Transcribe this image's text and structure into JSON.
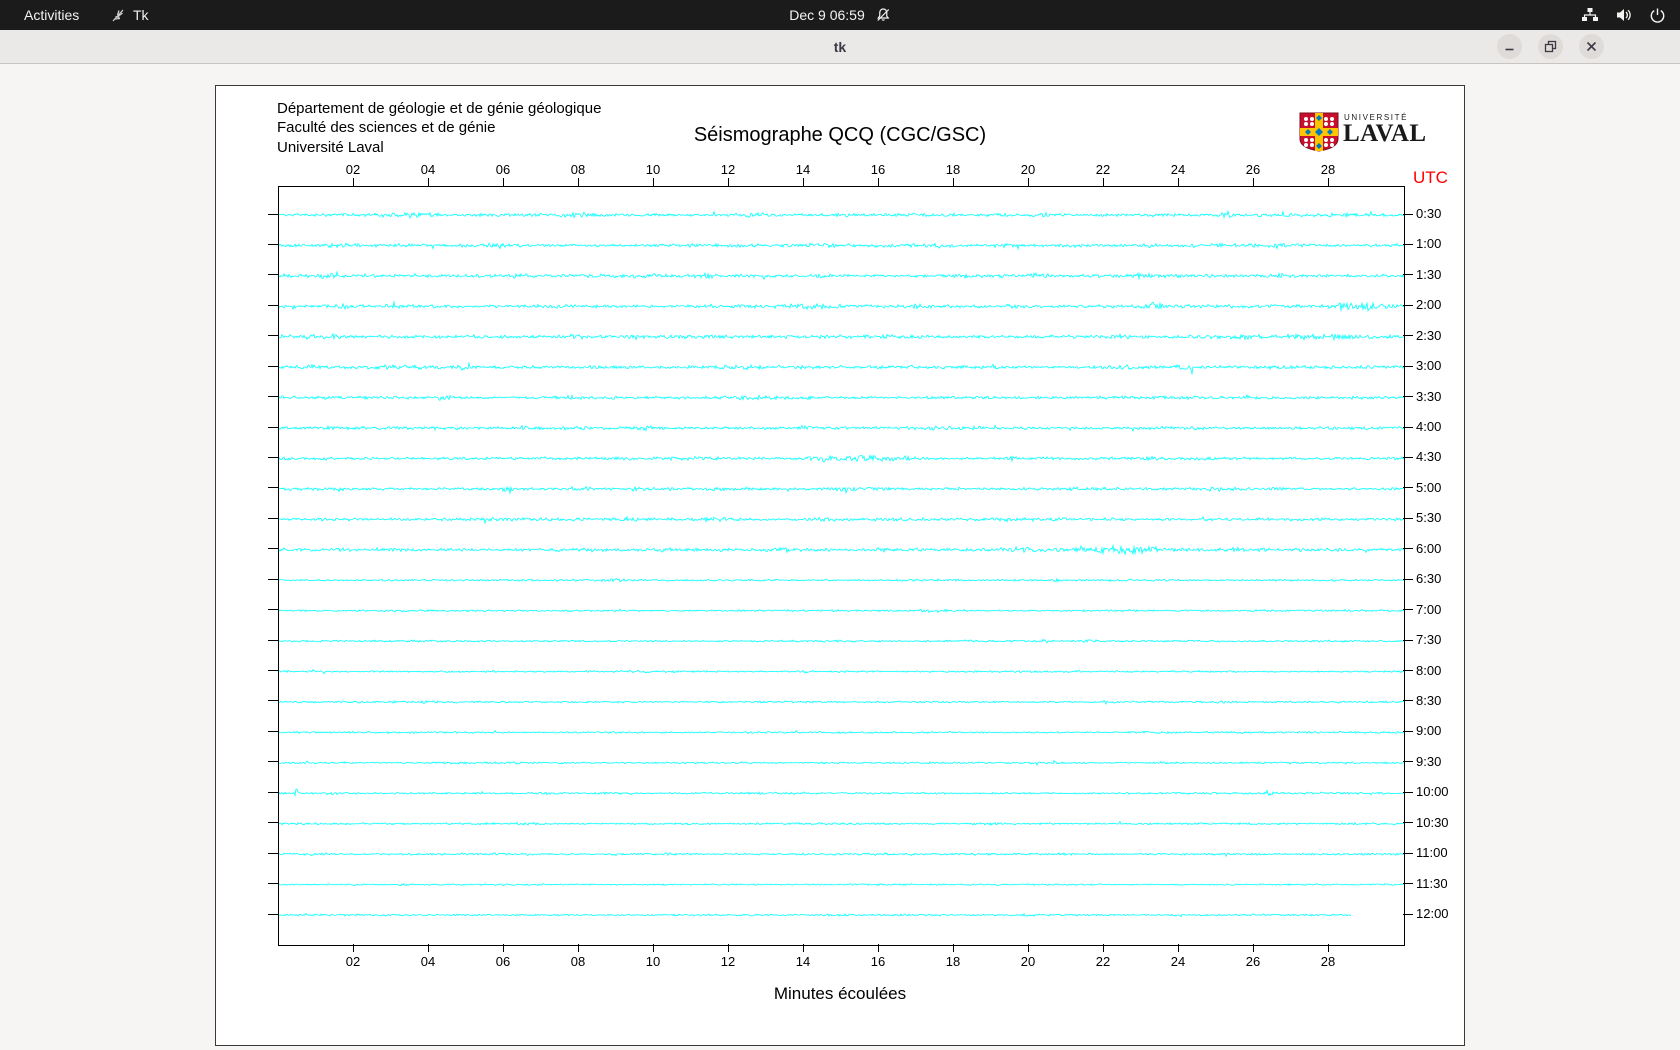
{
  "topbar": {
    "activities_label": "Activities",
    "app_name": "Tk",
    "clock": "Dec 9  06:59",
    "status_icons": [
      "network-wired-icon",
      "volume-icon",
      "power-icon"
    ],
    "notifications_muted": true
  },
  "window": {
    "title": "tk",
    "controls": [
      "minimize",
      "maximize",
      "close"
    ]
  },
  "header": {
    "line1": "Département de géologie et de génie géologique",
    "line2": "Faculté des sciences et de génie",
    "line3": "Université Laval",
    "title": "Séismographe QCQ (CGC/GSC)",
    "logo": {
      "line1": "UNIVERSITÉ",
      "line2": "LAVAL"
    }
  },
  "chart_data": {
    "type": "line",
    "title": "Séismographe QCQ (CGC/GSC)",
    "xlabel": "Minutes écoulées",
    "x_range": [
      0,
      30
    ],
    "x_ticks": [
      "02",
      "04",
      "06",
      "08",
      "10",
      "12",
      "14",
      "16",
      "18",
      "20",
      "22",
      "24",
      "26",
      "28"
    ],
    "right_axis_title": "UTC",
    "trace_color": "#00ffff",
    "grid": false,
    "traces": [
      {
        "label": "0:30",
        "base": 2.0,
        "end": 30,
        "events": [
          [
            3.5,
            0.5,
            2
          ],
          [
            8,
            0.3,
            1.2
          ],
          [
            12.6,
            0.4,
            1.5
          ],
          [
            20.5,
            0.3,
            1.5
          ],
          [
            25.3,
            0.15,
            3
          ],
          [
            26.8,
            0.2,
            2
          ]
        ]
      },
      {
        "label": "1:00",
        "base": 2.0,
        "end": 30,
        "events": [
          [
            5.9,
            0.3,
            1.5
          ],
          [
            14.5,
            0.3,
            1.2
          ],
          [
            17.5,
            0.4,
            1.5
          ],
          [
            19.2,
            0.3,
            1.5
          ],
          [
            23.2,
            0.2,
            1.2
          ]
        ]
      },
      {
        "label": "1:30",
        "base": 2.0,
        "end": 30,
        "events": [
          [
            1.3,
            0.3,
            1.6
          ],
          [
            6.4,
            0.3,
            1.5
          ],
          [
            11.5,
            0.5,
            1.6
          ],
          [
            14.3,
            0.3,
            1.4
          ],
          [
            20.3,
            0.25,
            2.8
          ],
          [
            23,
            0.2,
            1.4
          ],
          [
            26.6,
            0.3,
            1.6
          ]
        ]
      },
      {
        "label": "2:00",
        "base": 2.0,
        "end": 30,
        "events": [
          [
            1.8,
            0.3,
            1.5
          ],
          [
            7.4,
            0.3,
            1.5
          ],
          [
            14.3,
            0.6,
            2
          ],
          [
            17,
            0.3,
            1.4
          ],
          [
            19.5,
            0.3,
            1.6
          ],
          [
            23.3,
            0.3,
            1.5
          ],
          [
            28.8,
            0.8,
            3.2
          ]
        ]
      },
      {
        "label": "2:30",
        "base": 2.0,
        "end": 30,
        "events": [
          [
            1.4,
            0.3,
            1.5
          ],
          [
            8,
            0.5,
            1.8
          ],
          [
            9.6,
            0.3,
            1.5
          ],
          [
            16.5,
            0.3,
            1.2
          ],
          [
            22.5,
            0.3,
            1.5
          ],
          [
            25.8,
            0.25,
            2
          ],
          [
            27.8,
            0.8,
            3.2
          ]
        ]
      },
      {
        "label": "3:00",
        "base": 2.0,
        "end": 30,
        "events": [
          [
            0.8,
            0.25,
            2
          ],
          [
            3.3,
            0.3,
            1.6
          ],
          [
            4.9,
            0.3,
            1.8
          ],
          [
            12.3,
            0.4,
            1.5
          ],
          [
            22.6,
            0.3,
            2
          ],
          [
            24.2,
            0.25,
            1.6
          ]
        ]
      },
      {
        "label": "3:30",
        "base": 1.8,
        "end": 30,
        "events": [
          [
            4.4,
            0.12,
            3.4
          ],
          [
            7.8,
            0.3,
            1.5
          ],
          [
            12.4,
            0.4,
            1.6
          ],
          [
            18,
            0.2,
            1
          ],
          [
            25.9,
            0.15,
            1.8
          ]
        ]
      },
      {
        "label": "4:00",
        "base": 1.8,
        "end": 30,
        "events": [
          [
            1.4,
            0.4,
            1.6
          ],
          [
            6.4,
            0.3,
            1.4
          ],
          [
            9.9,
            0.3,
            1.4
          ],
          [
            14,
            0.3,
            1.2
          ],
          [
            17.4,
            0.3,
            1.3
          ],
          [
            24.5,
            0.2,
            1.2
          ]
        ]
      },
      {
        "label": "4:30",
        "base": 1.8,
        "end": 30,
        "events": [
          [
            14.6,
            0.4,
            2.2
          ],
          [
            15.6,
            0.7,
            2.6
          ],
          [
            16.8,
            0.4,
            1.8
          ],
          [
            19.6,
            0.12,
            2.2
          ],
          [
            23.2,
            0.2,
            1.2
          ]
        ]
      },
      {
        "label": "5:00",
        "base": 1.8,
        "end": 30,
        "events": [
          [
            6.1,
            0.3,
            1.5
          ],
          [
            8.2,
            0.3,
            1.4
          ],
          [
            9.5,
            0.25,
            1.5
          ],
          [
            15.2,
            0.3,
            1.3
          ],
          [
            25,
            0.2,
            1.2
          ]
        ]
      },
      {
        "label": "5:30",
        "base": 1.8,
        "end": 30,
        "events": [
          [
            9.4,
            0.3,
            1.5
          ],
          [
            11.6,
            0.3,
            1.4
          ],
          [
            14.6,
            0.3,
            1.3
          ],
          [
            19.3,
            0.2,
            1.1
          ]
        ]
      },
      {
        "label": "6:00",
        "base": 2.0,
        "end": 30,
        "events": [
          [
            10.4,
            0.3,
            1.6
          ],
          [
            16,
            0.2,
            1.8
          ],
          [
            19.8,
            0.6,
            1.8
          ],
          [
            21.3,
            0.15,
            2.6
          ],
          [
            22.4,
            0.8,
            2.6
          ],
          [
            23.1,
            0.3,
            2.2
          ],
          [
            25.6,
            0.25,
            1.4
          ]
        ]
      },
      {
        "label": "6:30",
        "base": 1.2,
        "end": 30,
        "events": [
          [
            9,
            0.3,
            0.8
          ],
          [
            20.7,
            0.06,
            8
          ]
        ]
      },
      {
        "label": "7:00",
        "base": 1.1,
        "end": 30,
        "events": [
          [
            17.5,
            0.5,
            1
          ],
          [
            26,
            0.2,
            0.7
          ]
        ]
      },
      {
        "label": "7:30",
        "base": 1.1,
        "end": 30,
        "events": [
          [
            20.4,
            0.1,
            1.8
          ],
          [
            21.6,
            0.3,
            1.1
          ]
        ]
      },
      {
        "label": "8:00",
        "base": 1.1,
        "end": 30,
        "events": [
          [
            2.8,
            0.3,
            0.7
          ],
          [
            14,
            0.3,
            0.6
          ]
        ]
      },
      {
        "label": "8:30",
        "base": 1.1,
        "end": 30,
        "events": [
          [
            4,
            2,
            0.5
          ],
          [
            25,
            0.3,
            0.6
          ]
        ]
      },
      {
        "label": "9:00",
        "base": 1.1,
        "end": 30,
        "events": [
          [
            23.2,
            0.2,
            0.9
          ]
        ]
      },
      {
        "label": "9:30",
        "base": 1.1,
        "end": 30,
        "events": [
          [
            12.4,
            0.25,
            1
          ],
          [
            23.6,
            0.2,
            0.9
          ]
        ]
      },
      {
        "label": "10:00",
        "base": 1.2,
        "end": 30,
        "events": [
          [
            0.5,
            0.08,
            6
          ],
          [
            1.3,
            0.2,
            1.6
          ],
          [
            7,
            0.3,
            0.9
          ],
          [
            26.4,
            0.06,
            5
          ]
        ]
      },
      {
        "label": "10:30",
        "base": 1.2,
        "end": 30,
        "events": [
          [
            6.6,
            0.25,
            1
          ],
          [
            19,
            0.25,
            0.9
          ]
        ]
      },
      {
        "label": "11:00",
        "base": 1.2,
        "end": 30,
        "events": [
          [
            1,
            0.25,
            1
          ],
          [
            10.4,
            0.2,
            0.9
          ],
          [
            18.4,
            0.2,
            0.9
          ],
          [
            21,
            0.2,
            0.8
          ]
        ]
      },
      {
        "label": "11:30",
        "base": 0.9,
        "end": 30,
        "events": [
          [
            3.3,
            0.08,
            3.5
          ]
        ]
      },
      {
        "label": "12:00",
        "base": 1.0,
        "end": 28.6,
        "events": [
          [
            15,
            0.3,
            0.9
          ],
          [
            16.6,
            0.25,
            1
          ],
          [
            20,
            0.3,
            0.9
          ]
        ]
      }
    ]
  }
}
